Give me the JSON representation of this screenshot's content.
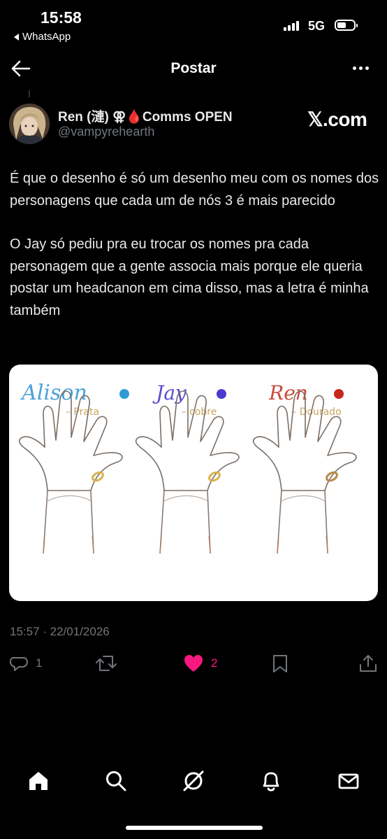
{
  "status_bar": {
    "time": "15:58",
    "back_app": "WhatsApp",
    "network": "5G",
    "battery_level": 0.55
  },
  "header": {
    "title": "Postar"
  },
  "post": {
    "author_name": "Ren (漣) ⚢🩸Comms OPEN",
    "handle": "@vampyrehearth",
    "source_label": "𝕏.com",
    "paragraphs": [
      "É que o desenho é só um desenho meu com os nomes dos personagens que cada um de nós 3 é mais parecido",
      "O Jay só pediu pra eu trocar os nomes pra cada personagem que a gente associa mais porque ele queria postar um headcanon em cima disso, mas a letra é minha também"
    ],
    "image": {
      "hands": [
        {
          "name": "Alison",
          "metal": "Prata",
          "dot_color": "#2e9bd3",
          "name_color": "#4aa3d8"
        },
        {
          "name": "Jay",
          "metal": "cobre",
          "dot_color": "#4b3ccf",
          "name_color": "#5a4bcf"
        },
        {
          "name": "Ren",
          "metal": "Dourado",
          "dot_color": "#c4271b",
          "name_color": "#c94a3a"
        }
      ]
    },
    "timestamp": "15:57 · 22/01/2026",
    "replies": "1",
    "likes": "2"
  },
  "colors": {
    "like": "#f91880",
    "muted": "#71767b"
  }
}
